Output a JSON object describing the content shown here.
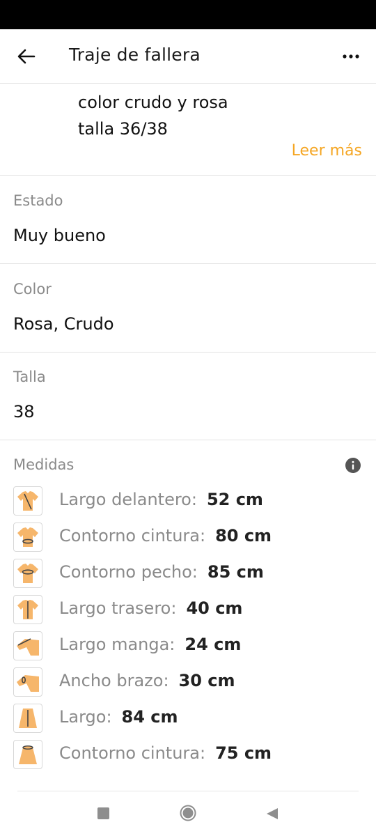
{
  "header": {
    "title": "Traje de fallera",
    "back_icon": "arrow-left-icon",
    "more_icon": "more-horizontal-icon"
  },
  "description": {
    "line1": "color crudo y rosa",
    "line2": "talla 36/38",
    "read_more": "Leer más"
  },
  "details": [
    {
      "label": "Estado",
      "value": "Muy bueno"
    },
    {
      "label": "Color",
      "value": "Rosa, Crudo"
    },
    {
      "label": "Talla",
      "value": "38"
    }
  ],
  "measures": {
    "label": "Medidas",
    "info_icon": "info-icon",
    "icon_color": "#f6b66b",
    "items": [
      {
        "name": "Largo delantero:",
        "value": "52 cm",
        "icon": "front-length-icon"
      },
      {
        "name": "Contorno cintura:",
        "value": "80 cm",
        "icon": "waist-icon"
      },
      {
        "name": "Contorno pecho:",
        "value": "85 cm",
        "icon": "chest-icon"
      },
      {
        "name": "Largo trasero:",
        "value": "40 cm",
        "icon": "back-length-icon"
      },
      {
        "name": "Largo manga:",
        "value": "24 cm",
        "icon": "sleeve-length-icon"
      },
      {
        "name": "Ancho brazo:",
        "value": "30 cm",
        "icon": "arm-width-icon"
      },
      {
        "name": "Largo:",
        "value": "84 cm",
        "icon": "skirt-length-icon"
      },
      {
        "name": "Contorno cintura:",
        "value": "75 cm",
        "icon": "skirt-waist-icon"
      }
    ]
  },
  "nav": {
    "recent_icon": "recent-apps-icon",
    "home_icon": "home-icon",
    "back_icon": "back-triangle-icon"
  },
  "colors": {
    "accent": "#f5a623",
    "muted_text": "#8a8a8a",
    "divider": "#e2e2e2"
  }
}
